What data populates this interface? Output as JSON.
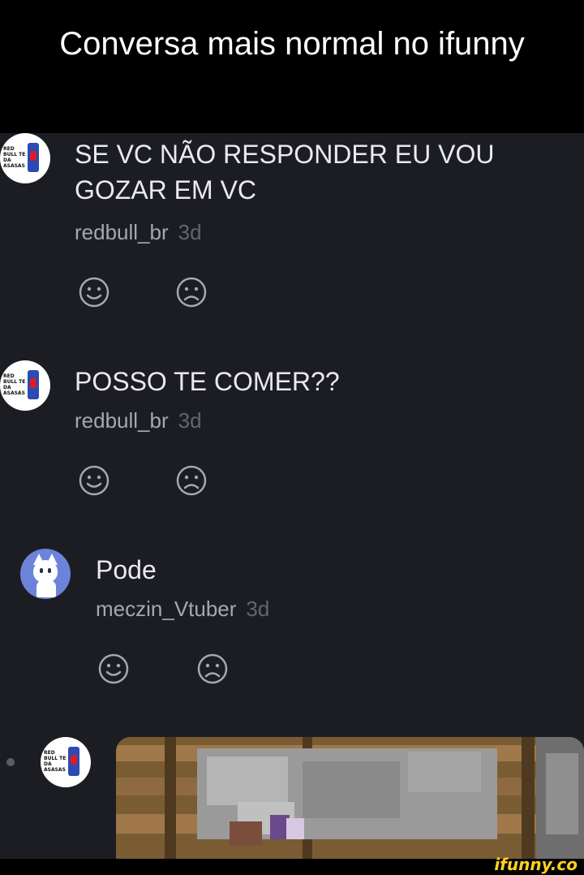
{
  "caption": "Conversa mais normal no ifunny",
  "comments": [
    {
      "text": "SE VC NÃO RESPONDER EU VOU GOZAR EM VC",
      "user": "redbull_br",
      "time": "3d",
      "avatar_text": "RED BULL TE DA ASASAS"
    },
    {
      "text": "POSSO TE COMER??",
      "user": "redbull_br",
      "time": "3d",
      "avatar_text": "RED BULL TE DA ASASAS"
    },
    {
      "text": "Pode",
      "user": "meczin_Vtuber",
      "time": "3d"
    }
  ],
  "next_comment": {
    "avatar_text": "RED BULL TE DA ASASAS"
  },
  "watermark": "ifunny.co",
  "icons": {
    "like": "smile-icon",
    "dislike": "frown-icon"
  },
  "colors": {
    "background": "#1c1d23",
    "text": "#e9e9ee",
    "username": "#a7a8ae",
    "time": "#64656c",
    "watermark": "#ffd21f"
  }
}
